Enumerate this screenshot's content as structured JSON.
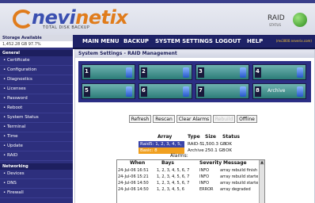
{
  "header": {
    "brand_main": "nevi",
    "brand_accent": "netix",
    "tagline": "TOTAL DISK BACKUP",
    "raid_label": "RAID",
    "raid_status": "STATUS"
  },
  "sidebar": {
    "storage_label": "Storage Available",
    "storage_value": "1,452.28 GB 97.7%",
    "general_label": "General",
    "general_items": [
      "Certificate",
      "Configuration",
      "Diagnostics",
      "Licenses",
      "Password",
      "Reboot",
      "System Status",
      "Terminal",
      "Time",
      "Update",
      "RAID"
    ],
    "networking_label": "Networking",
    "networking_items": [
      "Devices",
      "DNS",
      "Firewall"
    ]
  },
  "menu": {
    "items": [
      "MAIN MENU",
      "BACKUP",
      "SYSTEM SETTINGS",
      "LOGOUT",
      "HELP"
    ],
    "host": "(ms3000.neverix.com)"
  },
  "page": {
    "title": "System Settings - RAID Management"
  },
  "bays": {
    "row1": [
      {
        "num": "1",
        "label": ""
      },
      {
        "num": "2",
        "label": ""
      },
      {
        "num": "3",
        "label": ""
      },
      {
        "num": "4",
        "label": ""
      }
    ],
    "row2": [
      {
        "num": "5",
        "label": ""
      },
      {
        "num": "6",
        "label": ""
      },
      {
        "num": "7",
        "label": ""
      },
      {
        "num": "8",
        "label": "Archive"
      }
    ]
  },
  "buttons": {
    "refresh": "Refresh",
    "rescan": "Rescan",
    "clear_alarms": "Clear Alarms",
    "rebuild": "Rebuild",
    "offline": "Offline"
  },
  "arrays": {
    "headers": [
      "Array",
      "Type",
      "Size",
      "Status"
    ],
    "rows": [
      {
        "name": "Raid5: 1, 2, 3, 4, 5, 6, 7",
        "type": "RAID-5",
        "size": "1,500.3 GB",
        "status": "OK",
        "highlight": "#3a44a8",
        "text_color": "#ffffff"
      },
      {
        "name": "Basic: 8",
        "type": "Archive",
        "size": "250.1 GB",
        "status": "OK",
        "highlight": "#f0a020",
        "text_color": "#ffffff"
      }
    ]
  },
  "alarms": {
    "label": "Alarms:",
    "headers": [
      "When",
      "Bays",
      "Severity",
      "Message"
    ],
    "rows": [
      {
        "when": "24-Jul-06 16:51",
        "bays": "1, 2, 3, 4, 5, 6, 7",
        "severity": "INFO",
        "message": "array rebuild finish"
      },
      {
        "when": "24-Jul-06 15:21",
        "bays": "1, 2, 3, 4, 5, 6, 7",
        "severity": "INFO",
        "message": "array rebuild starte"
      },
      {
        "when": "24-Jul-06 14:50",
        "bays": "1, 2, 3, 4, 5, 6, 7",
        "severity": "INFO",
        "message": "array rebuild starte"
      },
      {
        "when": "24-Jul-06 14:50",
        "bays": "1, 2, 3, 4, 5, 6",
        "severity": "ERROR",
        "message": "array degraded"
      }
    ]
  },
  "colors": {
    "nav_bg": "#2d2f7d",
    "menu_bg": "#1e2266",
    "accent_orange": "#e07c1c",
    "bay_frame": "#2b2e84"
  }
}
